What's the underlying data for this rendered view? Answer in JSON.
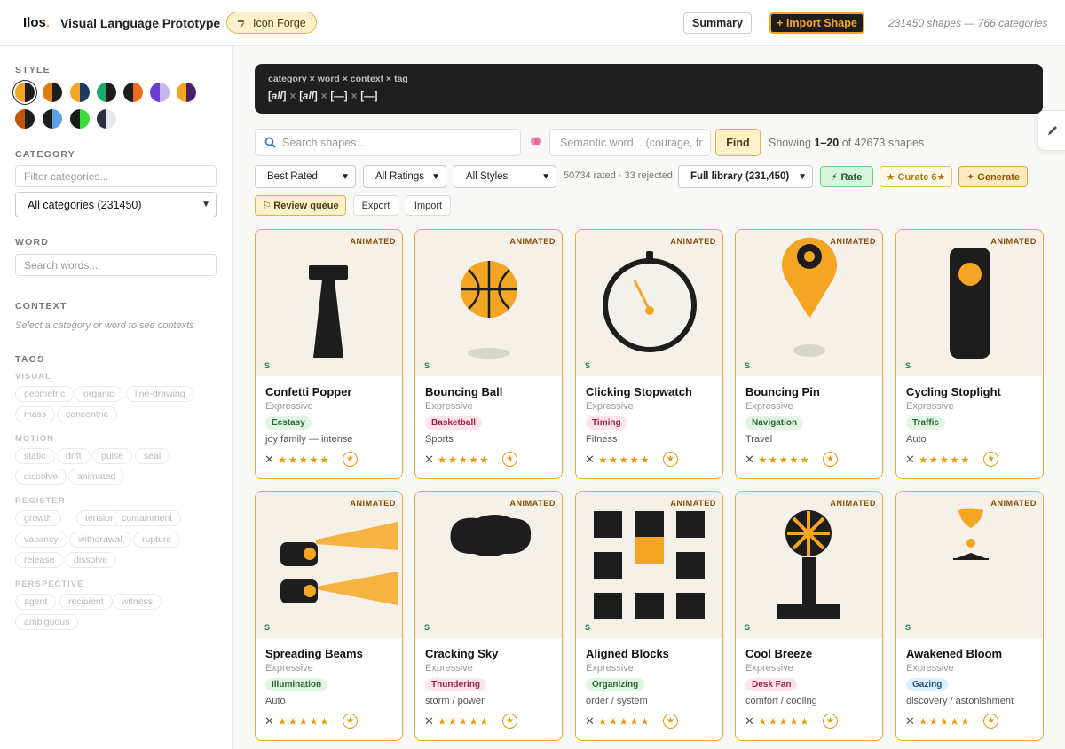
{
  "header": {
    "logo": "Ilos",
    "logo_dot": ".",
    "title": "Visual Language Prototype",
    "forge_icon": "hammer-icon",
    "forge_label": "Icon Forge",
    "summary_label": "Summary",
    "import_label": "+ Import Shape",
    "stats": "231450 shapes — 766 categories"
  },
  "sidebar": {
    "style_label": "STYLE",
    "style_swatches": [
      {
        "l": "#f5a524",
        "r": "#1d1d1d"
      },
      {
        "l": "#e07b12",
        "r": "#1d1d1d"
      },
      {
        "l": "#f5a524",
        "r": "#1e3a5f"
      },
      {
        "l": "#1faa6b",
        "r": "#1d1d1d"
      },
      {
        "l": "#1d1d1d",
        "r": "#f06a18"
      },
      {
        "l": "#6b3fd6",
        "r": "#c7b4f2"
      },
      {
        "l": "#f5a524",
        "r": "#4a1f63"
      },
      {
        "l": "#c0550c",
        "r": "#1d1d1d"
      },
      {
        "l": "#1d1d1d",
        "r": "#5aa0e6"
      },
      {
        "l": "#1d1d1d",
        "r": "#3bdc3b"
      },
      {
        "l": "#2a2f3a",
        "r": "#e8e8ee"
      }
    ],
    "category_label": "CATEGORY",
    "category_filter_placeholder": "Filter categories...",
    "category_select": "All categories (231450)",
    "word_label": "WORD",
    "word_placeholder": "Search words...",
    "context_label": "CONTEXT",
    "context_hint": "Select a category or word to see contexts",
    "tags_label": "TAGS",
    "visual_label": "VISUAL",
    "visual_tags": [
      "geometric",
      "organic",
      "line-drawing",
      "mass",
      "concentric"
    ],
    "motion_label": "MOTION",
    "motion_tags": [
      "static",
      "drift",
      "pulse",
      "seal",
      "dissolve",
      "animated"
    ],
    "register_label": "REGISTER",
    "register_tags": [
      "growth",
      "tension",
      "containment",
      "vacancy",
      "withdrawal",
      "rupture",
      "release",
      "dissolve"
    ],
    "perspective_label": "PERSPECTIVE",
    "perspective_tags": [
      "agent",
      "recipient",
      "witness",
      "ambiguous"
    ]
  },
  "query": {
    "line1": "category × word × context × tag",
    "line2_a": "[all]",
    "line2_b": "[all]",
    "line2_c": "[—]",
    "line2_d": "[—]",
    "sep": "×"
  },
  "search": {
    "placeholder": "Search shapes...",
    "semantic_placeholder": "Semantic word... (courage, fr",
    "find_label": "Find",
    "showing_prefix": "Showing ",
    "showing_range": "1–20",
    "showing_suffix": " of 42673 shapes"
  },
  "filters": {
    "sort": "Best Rated",
    "ratings": "All Ratings",
    "styles": "All Styles",
    "rated_info": "50734 rated · 33 rejected",
    "library": "Full library (231,450)",
    "rate_label": "⚡ Rate",
    "curate_label": "★ Curate 6★",
    "generate_label": "✦ Generate",
    "review_label": "⚐ Review queue",
    "export_label": "Export",
    "import_label": "Import"
  },
  "card_common": {
    "badge": "ANIMATED",
    "s_mark": "S",
    "reject": "✕",
    "stars": "★★★★★",
    "fav": "★"
  },
  "cards": [
    {
      "title": "Confetti Popper",
      "style": "Expressive",
      "pill": "Ecstasy",
      "pill_color": "green",
      "sub": "joy family — intense",
      "icon": "confetti-popper-icon"
    },
    {
      "title": "Bouncing Ball",
      "style": "Expressive",
      "pill": "Basketball",
      "pill_color": "pink",
      "sub": "Sports",
      "icon": "basketball-icon"
    },
    {
      "title": "Clicking Stopwatch",
      "style": "Expressive",
      "pill": "Timing",
      "pill_color": "pink",
      "sub": "Fitness",
      "icon": "stopwatch-icon"
    },
    {
      "title": "Bouncing Pin",
      "style": "Expressive",
      "pill": "Navigation",
      "pill_color": "green",
      "sub": "Travel",
      "icon": "map-pin-icon"
    },
    {
      "title": "Cycling Stoplight",
      "style": "Expressive",
      "pill": "Traffic",
      "pill_color": "green",
      "sub": "Auto",
      "icon": "stoplight-icon"
    },
    {
      "title": "Spreading Beams",
      "style": "Expressive",
      "pill": "Illumination",
      "pill_color": "green",
      "sub": "Auto",
      "icon": "headlight-beams-icon"
    },
    {
      "title": "Cracking Sky",
      "style": "Expressive",
      "pill": "Thundering",
      "pill_color": "pink",
      "sub": "storm / power",
      "icon": "storm-cloud-icon"
    },
    {
      "title": "Aligned Blocks",
      "style": "Expressive",
      "pill": "Organizing",
      "pill_color": "green",
      "sub": "order / system",
      "icon": "block-grid-icon"
    },
    {
      "title": "Cool Breeze",
      "style": "Expressive",
      "pill": "Desk Fan",
      "pill_color": "pink",
      "sub": "comfort / cooling",
      "icon": "desk-fan-icon"
    },
    {
      "title": "Awakened Bloom",
      "style": "Expressive",
      "pill": "Gazing",
      "pill_color": "blue",
      "sub": "discovery / astonishment",
      "icon": "bloom-icon"
    }
  ]
}
